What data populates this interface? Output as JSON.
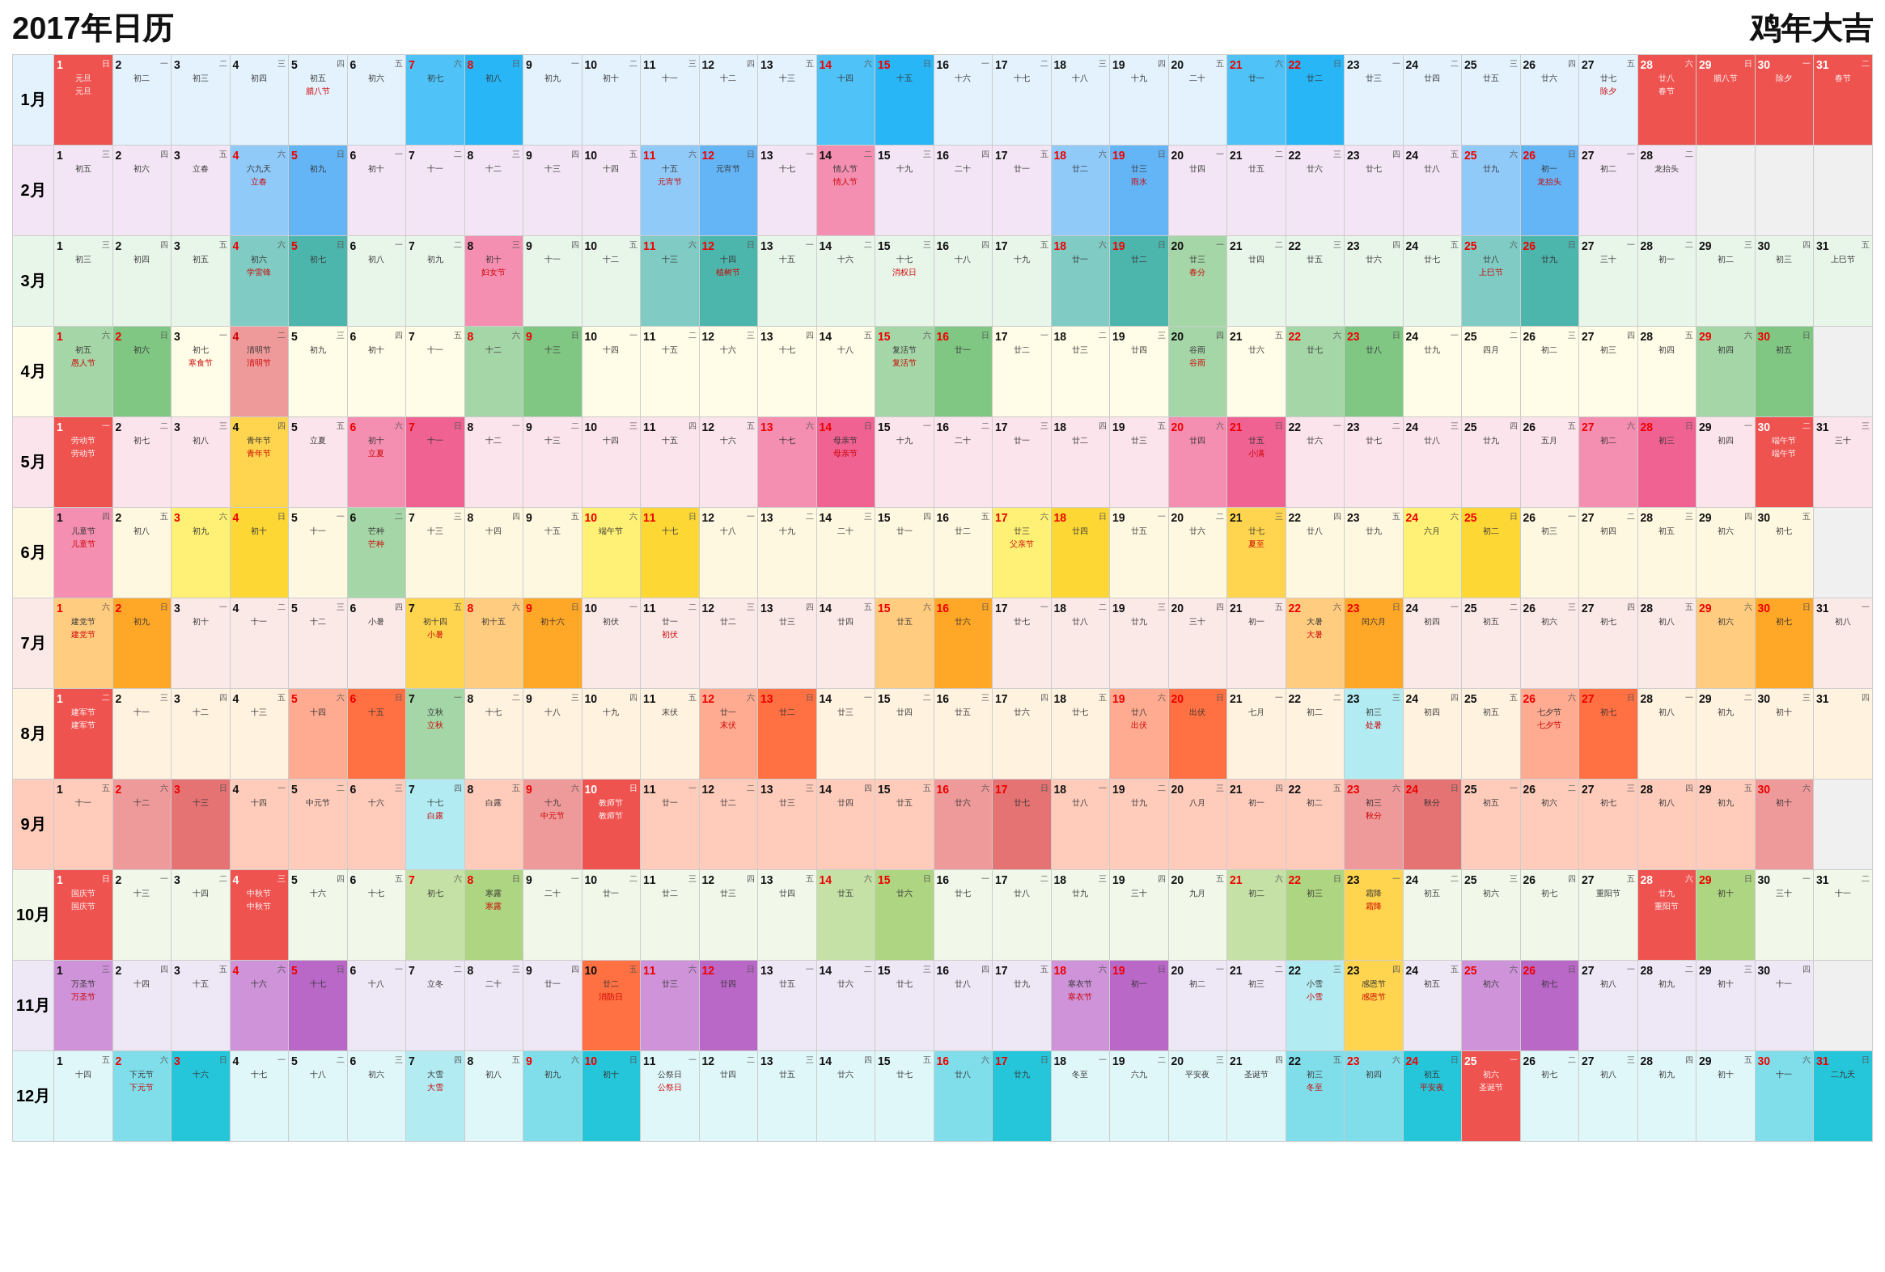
{
  "header": {
    "title": "2017年日历",
    "subtitle": "鸡年大吉"
  },
  "months": [
    {
      "label": "1月",
      "days": 31,
      "startWeekday": 0
    },
    {
      "label": "2月",
      "days": 28,
      "startWeekday": 3
    },
    {
      "label": "3月",
      "days": 31,
      "startWeekday": 3
    },
    {
      "label": "4月",
      "days": 30,
      "startWeekday": 6
    },
    {
      "label": "5月",
      "days": 31,
      "startWeekday": 1
    },
    {
      "label": "6月",
      "days": 30,
      "startWeekday": 4
    },
    {
      "label": "7月",
      "days": 31,
      "startWeekday": 6
    },
    {
      "label": "8月",
      "days": 31,
      "startWeekday": 2
    },
    {
      "label": "9月",
      "days": 30,
      "startWeekday": 5
    },
    {
      "label": "10月",
      "days": 31,
      "startWeekday": 0
    },
    {
      "label": "11月",
      "days": 30,
      "startWeekday": 3
    },
    {
      "label": "12月",
      "days": 31,
      "startWeekday": 5
    }
  ]
}
